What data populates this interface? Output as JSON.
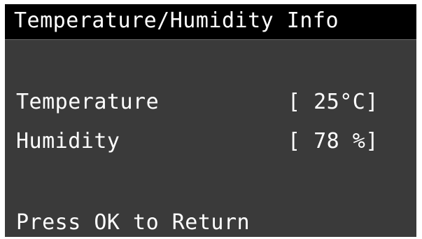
{
  "screen": {
    "title": "Temperature/Humidity Info",
    "rows": [
      {
        "label": "Temperature",
        "value": "[ 25°C]"
      },
      {
        "label": "Humidity",
        "value": "[ 78 %]"
      }
    ],
    "footer": "Press OK to Return"
  },
  "colors": {
    "title_background": "#000000",
    "screen_background": "#3a3a3a",
    "text": "#ffffff"
  }
}
